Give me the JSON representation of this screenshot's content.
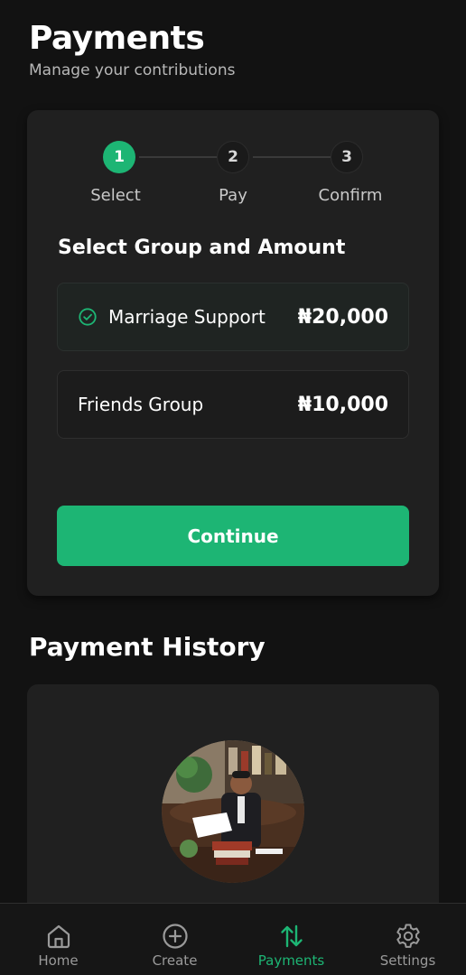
{
  "header": {
    "title": "Payments",
    "subtitle": "Manage your contributions"
  },
  "stepper": {
    "steps": [
      {
        "number": "1",
        "label": "Select",
        "active": true
      },
      {
        "number": "2",
        "label": "Pay",
        "active": false
      },
      {
        "number": "3",
        "label": "Confirm",
        "active": false
      }
    ]
  },
  "selection": {
    "heading": "Select Group and Amount",
    "groups": [
      {
        "name": "Marriage Support",
        "amount": "₦20,000",
        "selected": true
      },
      {
        "name": "Friends Group",
        "amount": "₦10,000",
        "selected": false
      }
    ],
    "continue_label": "Continue"
  },
  "history": {
    "title": "Payment History"
  },
  "nav": {
    "items": [
      {
        "label": "Home",
        "icon": "home-icon",
        "active": false
      },
      {
        "label": "Create",
        "icon": "plus-circle-icon",
        "active": false
      },
      {
        "label": "Payments",
        "icon": "swap-arrows-icon",
        "active": true
      },
      {
        "label": "Settings",
        "icon": "gear-icon",
        "active": false
      }
    ]
  },
  "colors": {
    "accent": "#1db574",
    "background": "#121212",
    "card": "#202020"
  }
}
